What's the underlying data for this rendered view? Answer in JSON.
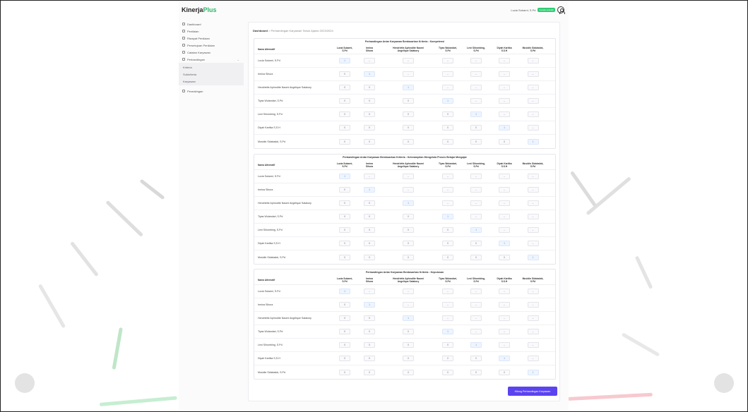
{
  "header": {
    "brand_main": "Kinerja",
    "brand_accent": "Plus",
    "user_name": "Lucia Sukarni, S.Pd",
    "user_badge": "Kepala sekolah"
  },
  "sidebar": {
    "items": [
      {
        "label": "Dashboard",
        "icon": "dashboard-icon"
      },
      {
        "label": "Penilaian",
        "icon": "clipboard-icon"
      },
      {
        "label": "Riwayat Penilaian",
        "icon": "history-icon"
      },
      {
        "label": "Persetujuan Penilaian",
        "icon": "check-icon"
      },
      {
        "label": "Catatan Karyawan",
        "icon": "note-icon"
      },
      {
        "label": "Perbandingan",
        "icon": "compare-icon"
      }
    ],
    "subitems": [
      "Kriteria",
      "Subkriteria",
      "Karyawan"
    ],
    "bottom_item": "Perankingan"
  },
  "breadcrumb": {
    "root": "Dashboard",
    "separator": ">",
    "current": "Perbandingan Karyawan Tahun Ajaran 2023/2024"
  },
  "columns": {
    "name_header": "Nama Alternatif",
    "alternatives": [
      [
        "Lucia Sukarni,",
        "S.Pd"
      ],
      [
        "Irmina",
        "Sihura"
      ],
      [
        "Hendriette Aphrodite Naomi",
        "Angelique Salakory"
      ],
      [
        "Tiyas Wulandari,",
        "S.Pd"
      ],
      [
        "Leni Sihombing,",
        "S.Pd"
      ],
      [
        "Diyah Kartika",
        "S.S.H"
      ],
      [
        "Musidin Sidabalok,",
        "S.Pd"
      ]
    ]
  },
  "rows": [
    "Lucia Sukarni, S.Pd",
    "Irmina Sihura",
    "Hendriette Aphrodite Naomi Angelique Salakory",
    "Tiyas Wulandari, S.Pd",
    "Leni Sihombing, S.Pd",
    "Diyah Kartika S,S.H",
    "Musidin Sidabalok, S.Pd"
  ],
  "tables": [
    {
      "title": "Perbandingan Antar Karyawan Berdasarkan Kriteria : Kompetensi"
    },
    {
      "title": "Perbandingan Antar Karyawan Berdasarkan Kriteria : Keterampilan Mengelola Proses Belajar Mengajar"
    },
    {
      "title": "Perbandingan Antar Karyawan Berdasarkan Kriteria : Keputusan"
    }
  ],
  "cell_values": {
    "diagonal": "1",
    "lower": "0",
    "upper_icon": "chevron-down-icon"
  },
  "action_button": "Hitung Perbandingan Karyawan",
  "colors": {
    "accent": "#5b43f0",
    "brand_accent": "#2fb56a",
    "badge": "#2ecc71"
  }
}
